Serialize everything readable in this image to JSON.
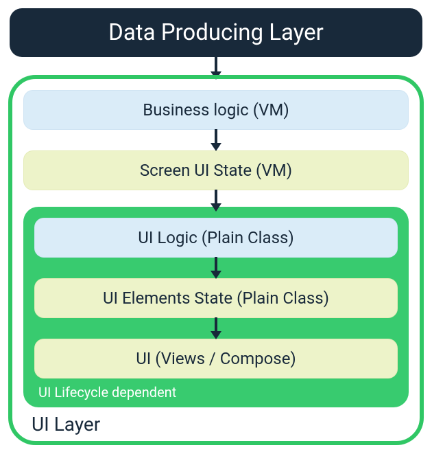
{
  "top": {
    "label": "Data Producing Layer"
  },
  "outer": {
    "box1": "Business logic (VM)",
    "box2": "Screen UI State (VM)",
    "label": "UI Layer"
  },
  "inner": {
    "box1": "UI Logic (Plain Class)",
    "box2": "UI Elements State (Plain Class)",
    "box3": "UI (Views / Compose)",
    "label": "UI Lifecycle dependent"
  }
}
